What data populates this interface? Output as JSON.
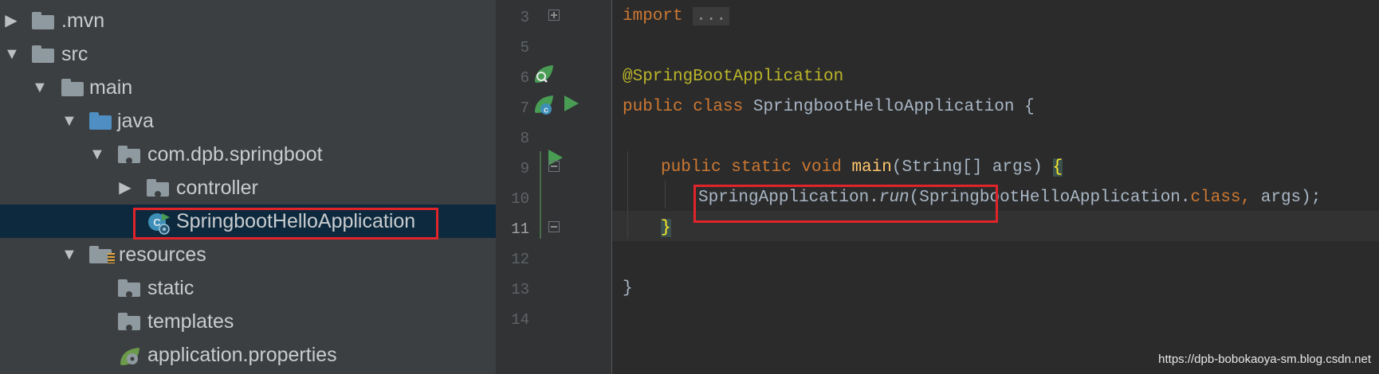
{
  "tree": {
    "items": [
      {
        "label": ".mvn",
        "expanded": false,
        "icon": "folder-icon"
      },
      {
        "label": "src",
        "expanded": true,
        "icon": "folder-icon"
      },
      {
        "label": "main",
        "expanded": true,
        "icon": "folder-icon"
      },
      {
        "label": "java",
        "expanded": true,
        "icon": "source-folder-icon"
      },
      {
        "label": "com.dpb.springboot",
        "expanded": true,
        "icon": "package-icon"
      },
      {
        "label": "controller",
        "expanded": false,
        "icon": "package-icon"
      },
      {
        "label": "SpringbootHelloApplication",
        "selected": true,
        "icon": "spring-boot-class-icon"
      },
      {
        "label": "resources",
        "expanded": true,
        "icon": "resources-folder-icon"
      },
      {
        "label": "static",
        "icon": "package-icon"
      },
      {
        "label": "templates",
        "icon": "package-icon"
      },
      {
        "label": "application.properties",
        "icon": "spring-properties-icon"
      }
    ]
  },
  "editor": {
    "line_numbers": [
      "3",
      "5",
      "6",
      "7",
      "8",
      "9",
      "10",
      "11",
      "12",
      "13",
      "14"
    ],
    "current_line": "11",
    "code": {
      "import_kw": "import",
      "import_fold": "...",
      "annotation": "@SpringBootApplication",
      "class_decl_kw": "public class",
      "class_name": " SpringbootHelloApplication ",
      "open_brace": "{",
      "main_kw": "public static void",
      "main_name": "main",
      "main_params": "(String[] args) ",
      "main_open_brace": "{",
      "run_target": "SpringApplication.",
      "run_method": "run",
      "run_args_start": "(SpringbootHelloApplication.",
      "run_class_kw": "class,",
      "run_args_end": " args);",
      "main_close_brace": "}",
      "class_close_brace": "}"
    }
  },
  "watermark": "https://dpb-bobokaoya-sm.blog.csdn.net",
  "colors": {
    "highlight_box": "#e0242a",
    "selection": "#0d293e",
    "keyword": "#cc7832",
    "annotation": "#bbb529",
    "function": "#ffc66d"
  }
}
